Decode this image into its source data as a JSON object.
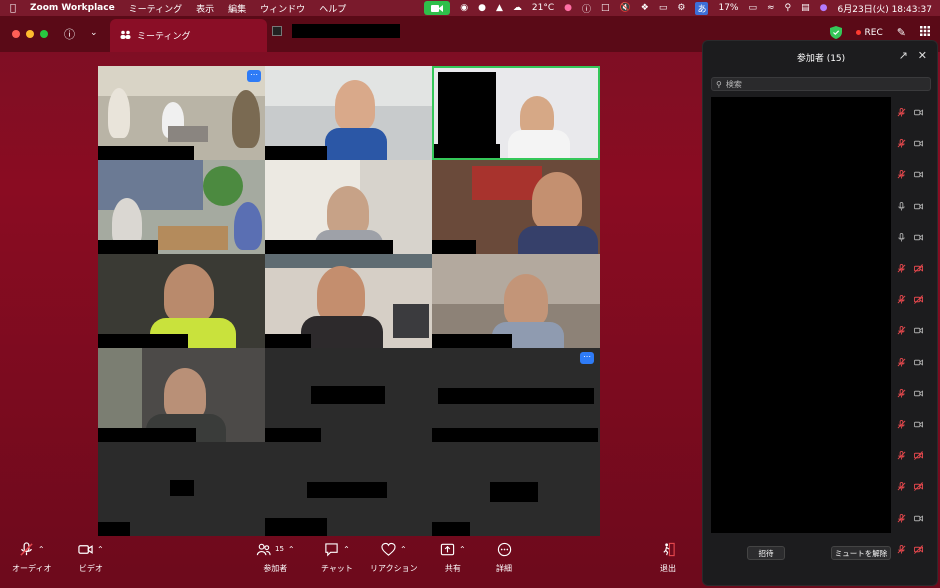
{
  "menubar": {
    "apple": "",
    "app_name": "Zoom Workplace",
    "menus": [
      "ミーティング",
      "表示",
      "編集",
      "ウィンドウ",
      "ヘルプ"
    ],
    "weather": "21°C",
    "battery": "17%",
    "datetime": "6月23日(火)  18:43:37",
    "input_mode": "あ"
  },
  "titlebar": {
    "tab_label": "ミーティング",
    "rec_label": "REC"
  },
  "grid": {
    "tile_count": 15
  },
  "panel": {
    "title": "参加者 (15)",
    "search_placeholder": "検索",
    "invite_label": "招待",
    "unmute_label": "ミュートを解除",
    "rows": [
      {
        "mic": "muted",
        "cam": "on"
      },
      {
        "mic": "muted",
        "cam": "on"
      },
      {
        "mic": "muted",
        "cam": "on"
      },
      {
        "mic": "on",
        "cam": "on"
      },
      {
        "mic": "on",
        "cam": "on"
      },
      {
        "mic": "muted",
        "cam": "off"
      },
      {
        "mic": "muted",
        "cam": "off"
      },
      {
        "mic": "muted",
        "cam": "on"
      },
      {
        "mic": "muted",
        "cam": "on"
      },
      {
        "mic": "muted",
        "cam": "on"
      },
      {
        "mic": "muted",
        "cam": "on"
      },
      {
        "mic": "muted",
        "cam": "off"
      },
      {
        "mic": "muted",
        "cam": "off"
      },
      {
        "mic": "muted",
        "cam": "on"
      },
      {
        "mic": "muted",
        "cam": "off"
      }
    ]
  },
  "toolbar": {
    "audio": "オーディオ",
    "video": "ビデオ",
    "participants": "参加者",
    "participants_count": "15",
    "chat": "チャット",
    "reactions": "リアクション",
    "share": "共有",
    "more": "詳細",
    "leave": "退出"
  },
  "colors": {
    "window_bg": "#7c0f24",
    "panel_bg": "#1c1c1e",
    "muted_red": "#e5484d",
    "active_speaker": "#35c759",
    "accent_blue": "#2e7bf6"
  }
}
